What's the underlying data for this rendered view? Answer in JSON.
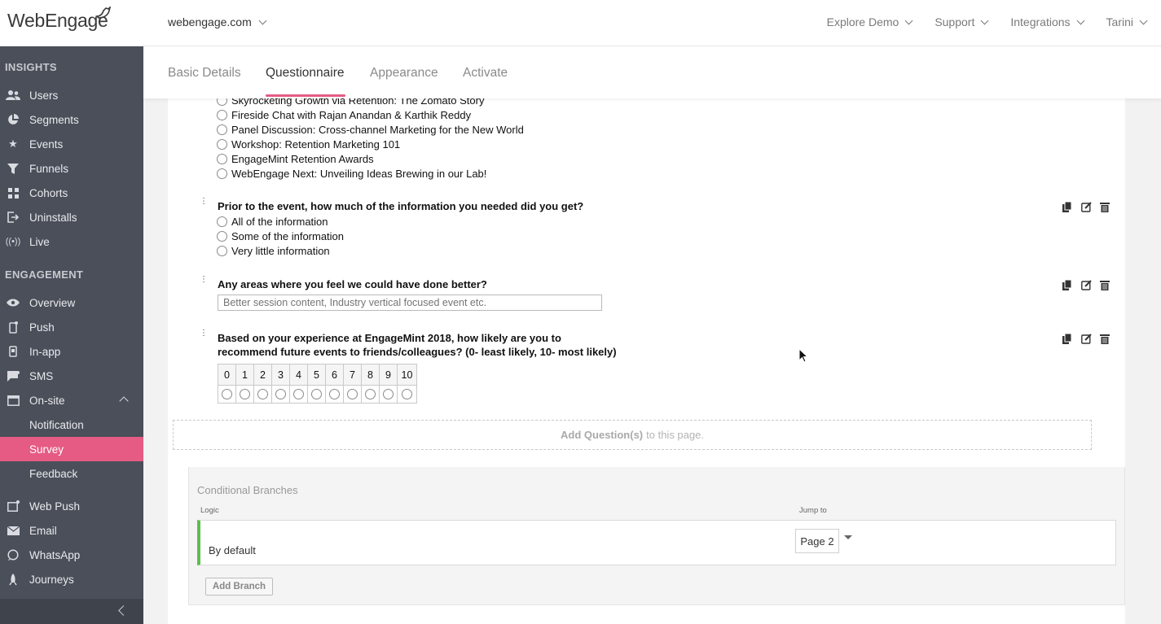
{
  "brand": {
    "logo_text": "WebEngage",
    "accent": "#e55b83",
    "sidebar_bg": "#4a4f5a",
    "branch_green": "#5fbd4e"
  },
  "topbar": {
    "account": "webengage.com",
    "nav": [
      {
        "label": "Explore Demo"
      },
      {
        "label": "Support"
      },
      {
        "label": "Integrations"
      },
      {
        "label": "Tarini"
      }
    ]
  },
  "sidebar": {
    "insights_title": "INSIGHTS",
    "insights": [
      {
        "label": "Users",
        "icon": "users-icon"
      },
      {
        "label": "Segments",
        "icon": "pie-chart-icon"
      },
      {
        "label": "Events",
        "icon": "star-icon"
      },
      {
        "label": "Funnels",
        "icon": "funnel-icon"
      },
      {
        "label": "Cohorts",
        "icon": "grid-icon"
      },
      {
        "label": "Uninstalls",
        "icon": "logout-icon"
      },
      {
        "label": "Live",
        "icon": "broadcast-icon"
      }
    ],
    "engagement_title": "ENGAGEMENT",
    "engagement": [
      {
        "label": "Overview",
        "icon": "eye-icon"
      },
      {
        "label": "Push",
        "icon": "mobile-icon"
      },
      {
        "label": "In-app",
        "icon": "tablet-icon"
      },
      {
        "label": "SMS",
        "icon": "chat-icon"
      },
      {
        "label": "On-site",
        "icon": "window-icon"
      },
      {
        "label": "Notification"
      },
      {
        "label": "Survey"
      },
      {
        "label": "Feedback"
      },
      {
        "label": "Web Push",
        "icon": "browser-icon"
      },
      {
        "label": "Email",
        "icon": "mail-icon"
      },
      {
        "label": "WhatsApp",
        "icon": "whatsapp-icon"
      },
      {
        "label": "Journeys",
        "icon": "rocket-icon"
      }
    ]
  },
  "tabs": [
    {
      "label": "Basic Details"
    },
    {
      "label": "Questionnaire",
      "active": true
    },
    {
      "label": "Appearance"
    },
    {
      "label": "Activate"
    }
  ],
  "questions": {
    "q1": {
      "options": [
        "Skyrocketing Growth via Retention: The Zomato Story",
        "Fireside Chat with Rajan Anandan & Karthik Reddy",
        "Panel Discussion: Cross-channel Marketing for the New World",
        "Workshop: Retention Marketing 101",
        "EngageMint Retention Awards",
        "WebEngage Next: Unveiling Ideas Brewing in our Lab!"
      ]
    },
    "q2": {
      "title": "Prior to the event, how much of the information you needed did you get?",
      "options": [
        "All of the information",
        "Some of the information",
        "Very little information"
      ]
    },
    "q3": {
      "title": "Any areas where you feel we could have done better?",
      "placeholder": "Better session content, Industry vertical focused event etc."
    },
    "q4": {
      "title_line1": "Based on your experience at EngageMint 2018, how likely are you to",
      "title_line2": "recommend future events to friends/colleagues? (0- least likely, 10- most likely)",
      "scale": [
        "0",
        "1",
        "2",
        "3",
        "4",
        "5",
        "6",
        "7",
        "8",
        "9",
        "10"
      ]
    }
  },
  "add_question": {
    "bold": "Add Question(s)",
    "rest": "to this page."
  },
  "conditional": {
    "title": "Conditional Branches",
    "logic_label": "Logic",
    "jump_label": "Jump to",
    "default_text": "By default",
    "page_value": "Page 2",
    "add_branch": "Add Branch"
  }
}
